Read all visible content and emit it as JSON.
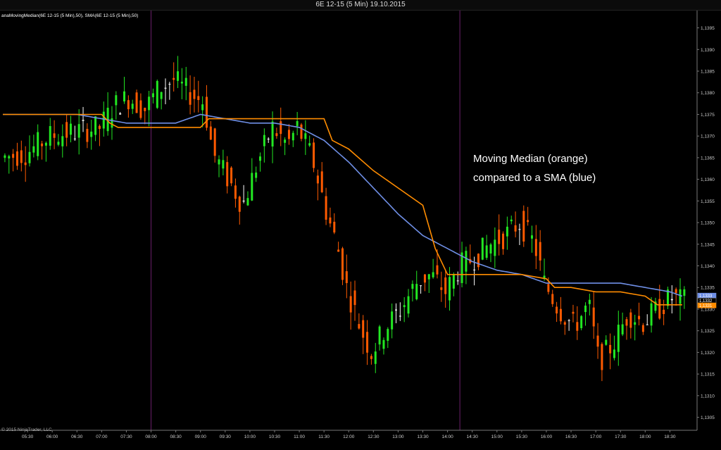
{
  "window": {
    "title": "6E 12-15 (5 Min)  19.10.2015"
  },
  "indicator_label": "anaMovingMedian(6E 12-15 (5 Min),50), SMA(6E 12-15 (5 Min),50)",
  "copyright": "© 2015 NinjaTrader, LLC",
  "annotation": {
    "line1": "Moving Median (orange)",
    "line2": "compared to a SMA (blue)"
  },
  "colors": {
    "background": "#000000",
    "up": "#22e822",
    "down": "#ff5a00",
    "doji": "#ffffff",
    "median": "#ff8c00",
    "sma": "#6f8fe6",
    "session_divider": "#6a1f6a",
    "axis": "#777777"
  },
  "chart_data": {
    "type": "line",
    "title": "6E 12-15 (5 Min)  19.10.2015",
    "xlabel": "",
    "ylabel": "",
    "x_ticks": [
      "05:30",
      "06:00",
      "06:30",
      "07:00",
      "07:30",
      "08:00",
      "08:30",
      "09:00",
      "09:30",
      "10:00",
      "10:30",
      "11:00",
      "11:30",
      "12:00",
      "12:30",
      "13:00",
      "13:30",
      "14:00",
      "14:30",
      "15:00",
      "15:30",
      "16:00",
      "16:30",
      "17:00",
      "17:30",
      "18:00",
      "18:30"
    ],
    "y_ticks": [
      "1,1305",
      "1,1310",
      "1,1315",
      "1,1320",
      "1,1325",
      "1,1330",
      "1,1335",
      "1,1340",
      "1,1345",
      "1,1350",
      "1,1355",
      "1,1360",
      "1,1365",
      "1,1370",
      "1,1375",
      "1,1380",
      "1,1385",
      "1,1390",
      "1,1395"
    ],
    "ylim": [
      1.1302,
      1.1399
    ],
    "x_hours": [
      5.0,
      19.05
    ],
    "session_dividers": [
      "08:00",
      "14:15"
    ],
    "series": [
      {
        "name": "",
        "role": "sma",
        "x": [
          "05:00",
          "05:30",
          "06:00",
          "06:30",
          "07:00",
          "07:30",
          "08:00",
          "08:30",
          "09:00",
          "09:30",
          "10:00",
          "10:30",
          "11:00",
          "11:30",
          "12:00",
          "12:30",
          "13:00",
          "13:30",
          "14:00",
          "14:30",
          "15:00",
          "15:30",
          "16:00",
          "16:30",
          "17:00",
          "17:30",
          "18:00",
          "18:30",
          "18:45"
        ],
        "values": [
          1.1375,
          1.1375,
          1.1375,
          1.1375,
          1.1374,
          1.1373,
          1.1373,
          1.1373,
          1.1375,
          1.1374,
          1.1373,
          1.1373,
          1.1372,
          1.1369,
          1.1364,
          1.1358,
          1.1352,
          1.1347,
          1.1344,
          1.1341,
          1.1339,
          1.1338,
          1.1336,
          1.1336,
          1.1336,
          1.1336,
          1.1335,
          1.1334,
          1.1333
        ]
      },
      {
        "name": "",
        "role": "median",
        "x": [
          "05:00",
          "06:00",
          "07:00",
          "07:10",
          "07:20",
          "07:30",
          "08:00",
          "08:30",
          "09:00",
          "09:10",
          "09:20",
          "10:00",
          "10:30",
          "11:00",
          "11:30",
          "11:40",
          "12:00",
          "12:30",
          "12:45",
          "13:00",
          "13:30",
          "13:45",
          "14:00",
          "14:30",
          "15:00",
          "15:30",
          "16:00",
          "16:10",
          "16:30",
          "17:00",
          "17:30",
          "18:00",
          "18:15",
          "18:30",
          "18:45"
        ],
        "values": [
          1.1375,
          1.1375,
          1.1375,
          1.1373,
          1.1372,
          1.1372,
          1.1372,
          1.1372,
          1.1372,
          1.1374,
          1.1374,
          1.1374,
          1.1374,
          1.1374,
          1.1374,
          1.1369,
          1.1367,
          1.1362,
          1.136,
          1.1358,
          1.1354,
          1.1344,
          1.1338,
          1.1338,
          1.1338,
          1.1338,
          1.1337,
          1.1335,
          1.1335,
          1.1334,
          1.1334,
          1.1333,
          1.1331,
          1.1331,
          1.1331
        ]
      }
    ],
    "last_values": {
      "sma": "1,1333",
      "close": "1,1332",
      "median": "1,1331"
    }
  }
}
